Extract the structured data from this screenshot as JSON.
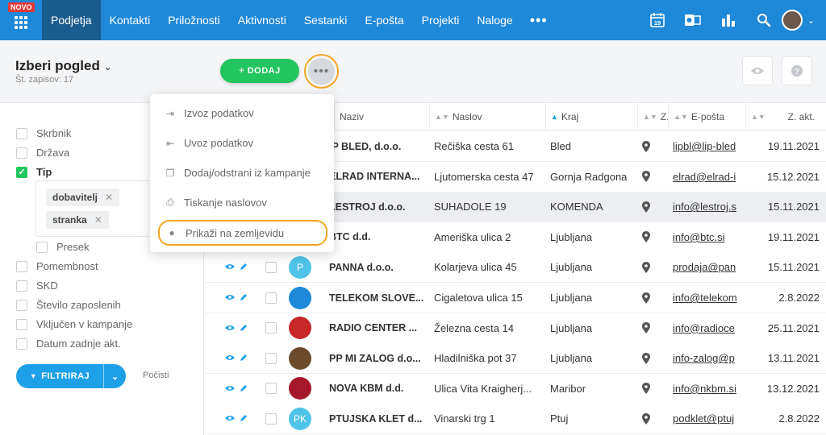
{
  "topbar": {
    "badge": "NOVO",
    "nav": [
      "Podjetja",
      "Kontakti",
      "Priložnosti",
      "Aktivnosti",
      "Sestanki",
      "E-pošta",
      "Projekti",
      "Naloge"
    ],
    "more": "•••",
    "calendar_day": "19"
  },
  "view": {
    "title": "Izberi pogled",
    "count": "Št. zapisov: 17",
    "add_label": "+ DODAJ",
    "more_label": "•••"
  },
  "menu": {
    "items": [
      "Izvoz podatkov",
      "Uvoz podatkov",
      "Dodaj/odstrani iz kampanje",
      "Tiskanje naslovov",
      "Prikaži na zemljevidu"
    ]
  },
  "filters": {
    "items": [
      "Skrbnik",
      "Država",
      "Tip",
      "Presek",
      "Pomembnost",
      "SKD",
      "Število zaposlenih",
      "Vključen v kampanje",
      "Datum zadnje akt."
    ],
    "tags": [
      "dobavitelj",
      "stranka"
    ],
    "filter_label": "FILTRIRAJ",
    "clear_label": "Počisti"
  },
  "table": {
    "headers": [
      "Naziv",
      "Naslov",
      "Kraj",
      "Z.",
      "E-pošta",
      "Z. akt."
    ],
    "rows": [
      {
        "name": "IP BLED, d.o.o.",
        "address": "Rečiška cesta 61",
        "city": "Bled",
        "email": "lipbl@lip-bled",
        "date": "19.11.2021"
      },
      {
        "name": "ELRAD INTERNA...",
        "address": "Ljutomerska cesta 47",
        "city": "Gornja Radgona",
        "email": "elrad@elrad-i",
        "date": "15.12.2021"
      },
      {
        "name": "LESTROJ d.o.o.",
        "address": "SUHADOLE 19",
        "city": "KOMENDA",
        "email": "info@lestroj.s",
        "date": "15.11.2021"
      },
      {
        "name": "BTC d.d.",
        "address": "Ameriška ulica 2",
        "city": "Ljubljana",
        "email": "info@btc.si",
        "date": "19.11.2021"
      },
      {
        "name": "PANNA d.o.o.",
        "address": "Kolarjeva ulica 45",
        "city": "Ljubljana",
        "email": "prodaja@pan",
        "date": "15.11.2021",
        "initials": "P"
      },
      {
        "name": "TELEKOM SLOVE...",
        "address": "Cigaletova ulica 15",
        "city": "Ljubljana",
        "email": "info@telekom",
        "date": "2.8.2022"
      },
      {
        "name": "RADIO CENTER ...",
        "address": "Železna cesta 14",
        "city": "Ljubljana",
        "email": "info@radioce",
        "date": "25.11.2021"
      },
      {
        "name": "PP MI ZALOG d.o...",
        "address": "Hladilniška pot 37",
        "city": "Ljubljana",
        "email": "info-zalog@p",
        "date": "13.11.2021"
      },
      {
        "name": "NOVA KBM d.d.",
        "address": "Ulica Vita Kraigherj...",
        "city": "Maribor",
        "email": "info@nkbm.si",
        "date": "13.12.2021"
      },
      {
        "name": "PTUJSKA KLET d...",
        "address": "Vinarski trg 1",
        "city": "Ptuj",
        "email": "podklet@ptuj",
        "date": "2.8.2022",
        "initials": "PK"
      }
    ]
  },
  "colors": {
    "topbar": "#1e88d9",
    "active_tab": "#1b5c8f",
    "add_button": "#22c55e",
    "highlight": "#f5a623",
    "accent": "#1ea0e8"
  }
}
